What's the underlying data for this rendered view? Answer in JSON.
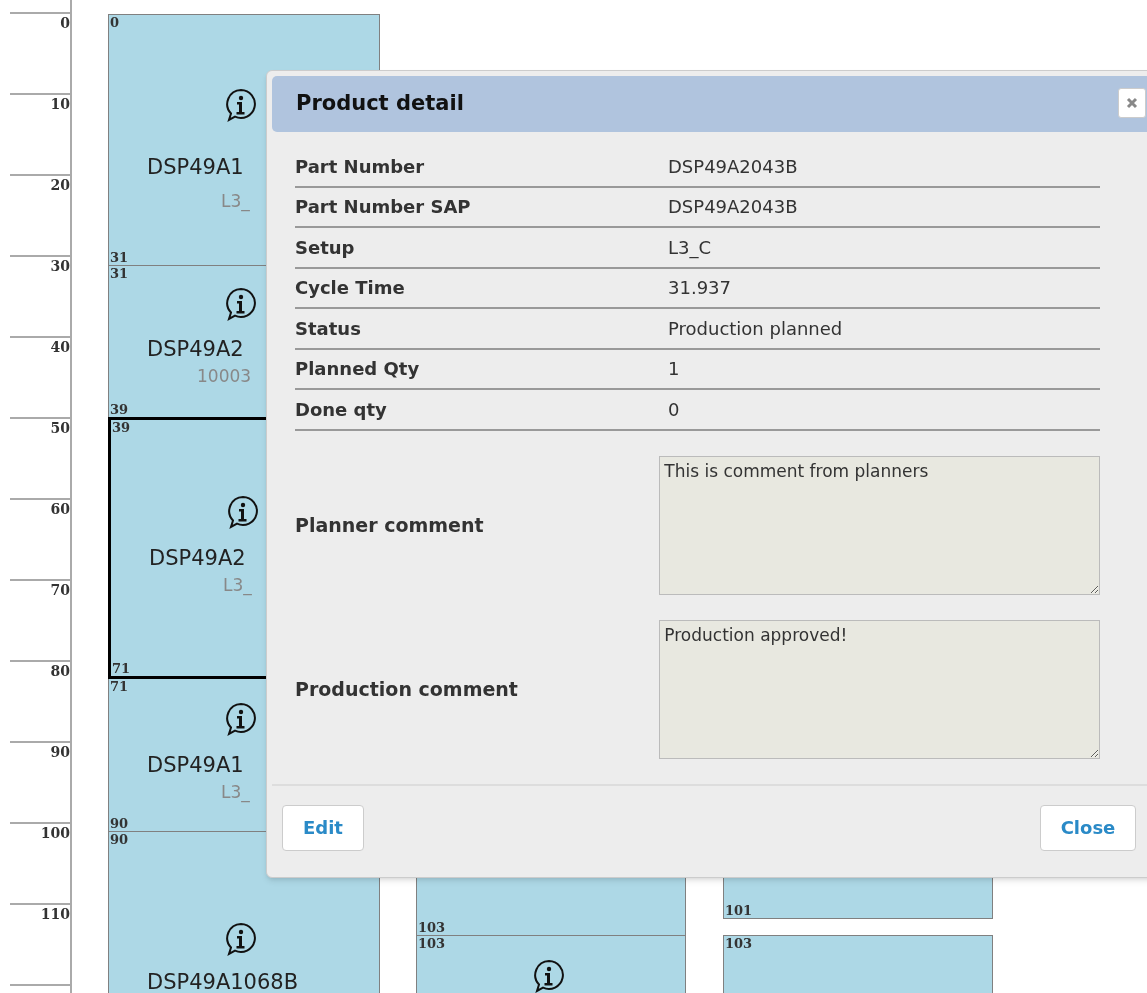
{
  "ruler": {
    "ticks": [
      "0",
      "10",
      "20",
      "30",
      "40",
      "50",
      "60",
      "70",
      "80",
      "90",
      "100",
      "110"
    ]
  },
  "lanes": [
    {
      "blocks": [
        {
          "start": "0",
          "end": "31",
          "part": "DSP49A1",
          "sub": "L3_",
          "has_icon": true,
          "selected": false
        },
        {
          "start": "31",
          "end": "39",
          "part": "DSP49A2",
          "sub": "10003",
          "has_icon": true,
          "selected": false
        },
        {
          "start": "39",
          "end": "71",
          "part": "DSP49A2",
          "sub": "L3_",
          "has_icon": true,
          "selected": true
        },
        {
          "start": "71",
          "end": "90",
          "part": "DSP49A1",
          "sub": "L3_",
          "has_icon": true,
          "selected": false
        },
        {
          "start": "90",
          "part": "DSP49A1068B",
          "has_icon": true,
          "selected": false
        }
      ]
    },
    {
      "blocks": [
        {
          "end": "103",
          "selected": false
        },
        {
          "start": "103",
          "has_icon": true,
          "selected": false
        }
      ]
    },
    {
      "blocks": [
        {
          "end": "101",
          "selected": false
        },
        {
          "start": "103",
          "has_icon": false,
          "selected": false
        }
      ]
    }
  ],
  "dialog": {
    "title": "Product detail",
    "fields": [
      {
        "label": "Part Number",
        "value": "DSP49A2043B"
      },
      {
        "label": "Part Number SAP",
        "value": "DSP49A2043B"
      },
      {
        "label": "Setup",
        "value": "L3_C"
      },
      {
        "label": "Cycle Time",
        "value": "31.937"
      },
      {
        "label": "Status",
        "value": "Production planned"
      },
      {
        "label": "Planned Qty",
        "value": "1"
      },
      {
        "label": "Done qty",
        "value": "0"
      }
    ],
    "comments": [
      {
        "label": "Planner comment",
        "value": "This is comment from planners"
      },
      {
        "label": "Production comment",
        "value": "Production approved!"
      }
    ],
    "buttons": [
      "Edit",
      "Close"
    ]
  }
}
